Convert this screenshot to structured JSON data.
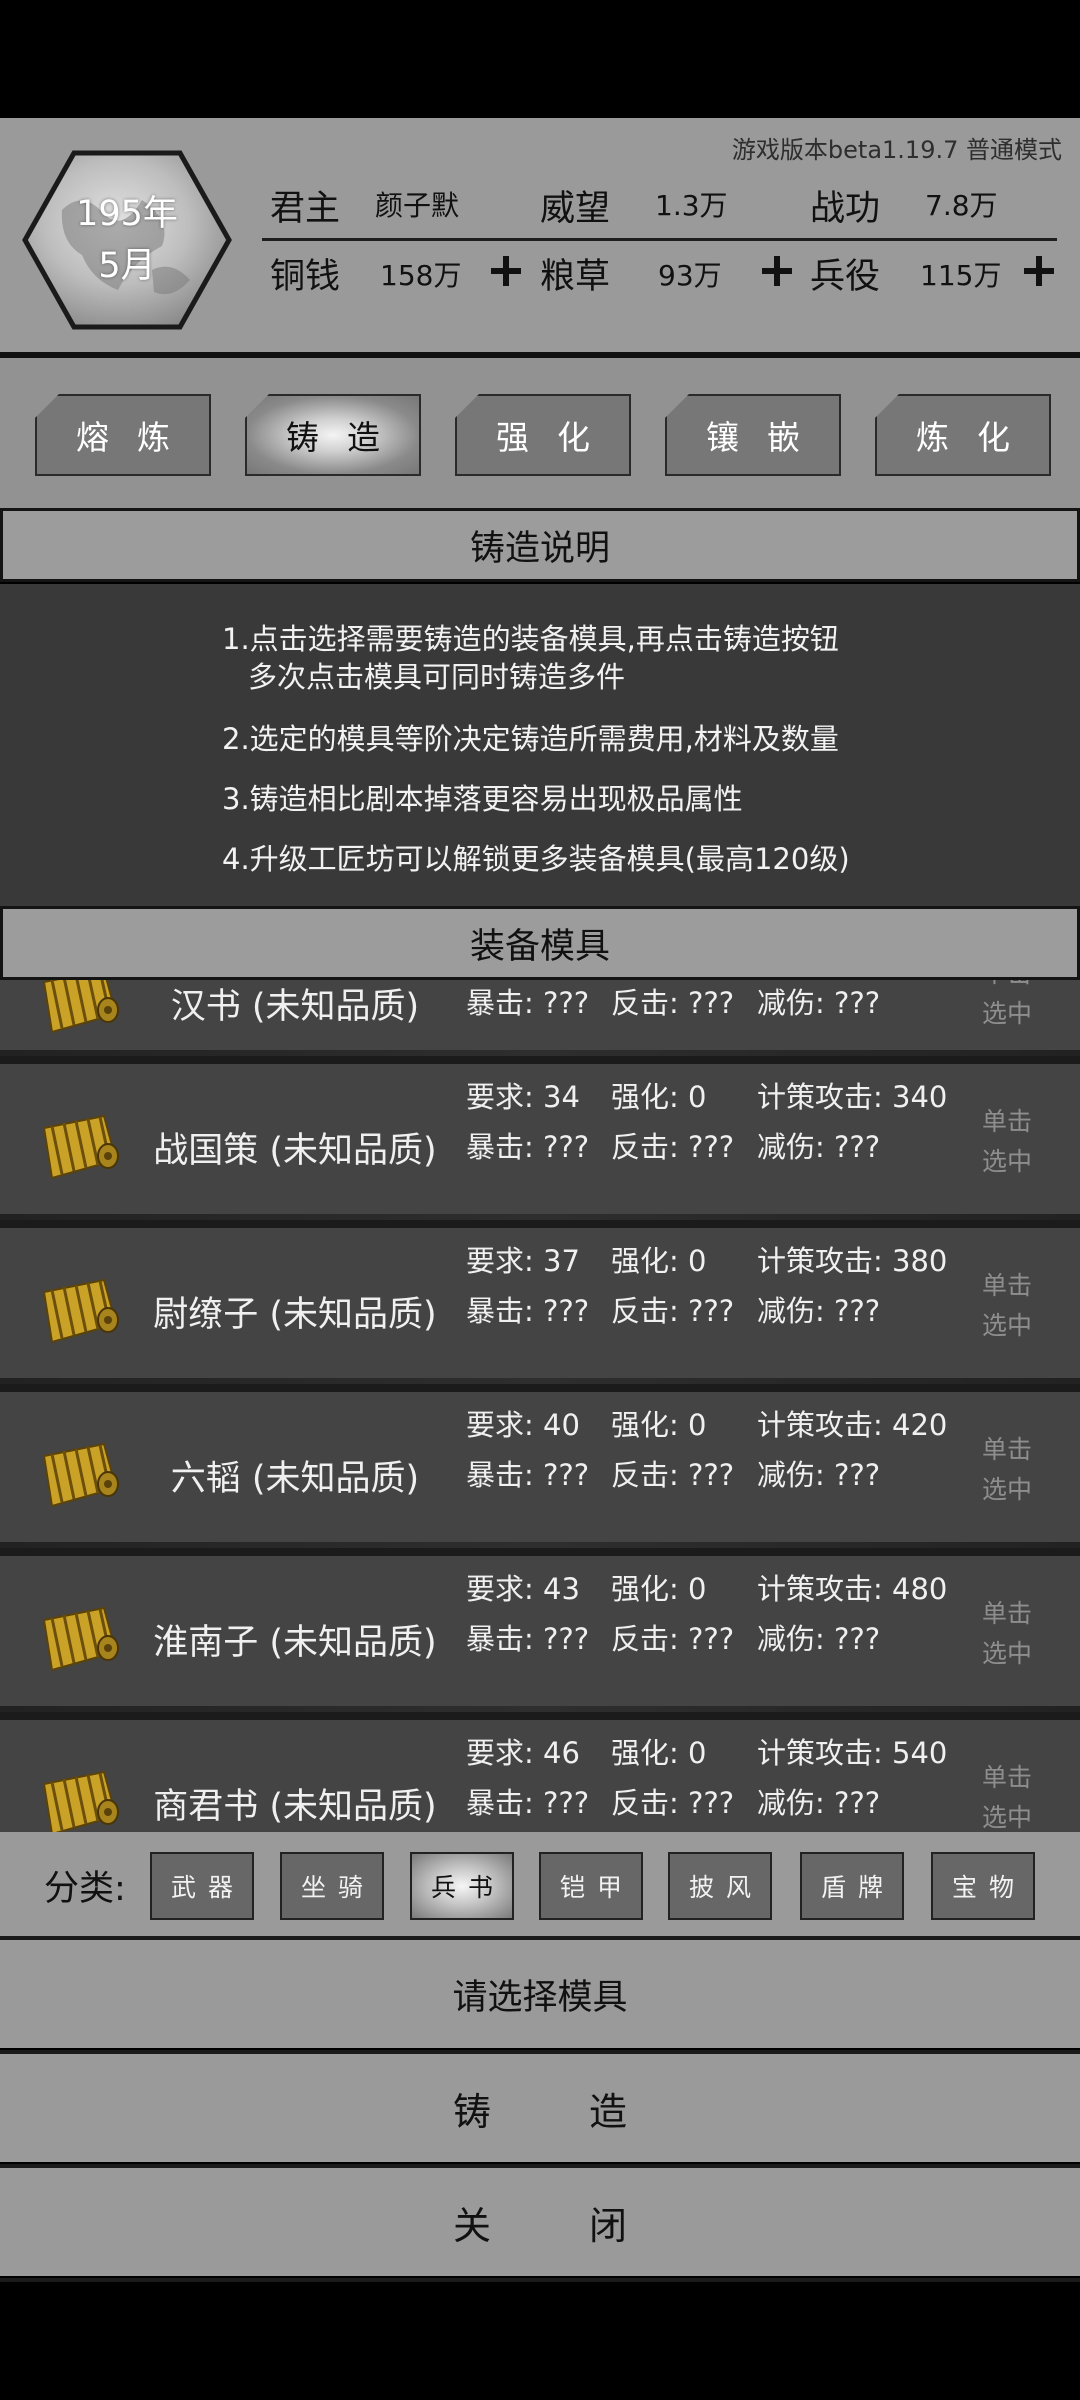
{
  "header": {
    "version": "游戏版本beta1.19.7   普通模式",
    "date_year": "195年",
    "date_month": "5月",
    "stats_row1": [
      {
        "label": "君主",
        "value": "颜子默"
      },
      {
        "label": "威望",
        "value": "1.3万"
      },
      {
        "label": "战功",
        "value": "7.8万"
      }
    ],
    "stats_row2": [
      {
        "label": "铜钱",
        "value": "158万"
      },
      {
        "label": "粮草",
        "value": "93万"
      },
      {
        "label": "兵役",
        "value": "115万"
      }
    ]
  },
  "tabs": [
    {
      "label": "熔炼",
      "active": false
    },
    {
      "label": "铸造",
      "active": true
    },
    {
      "label": "强化",
      "active": false
    },
    {
      "label": "镶嵌",
      "active": false
    },
    {
      "label": "炼化",
      "active": false
    }
  ],
  "description": {
    "title": "铸造说明",
    "lines": [
      "1.点击选择需要铸造的装备模具,再点击铸造按钮",
      "多次点击模具可同时铸造多件",
      "2.选定的模具等阶决定铸造所需费用,材料及数量",
      "3.铸造相比剧本掉落更容易出现极品属性",
      "4.升级工匠坊可以解锁更多装备模具(最高120级)"
    ]
  },
  "molds": {
    "title": "装备模具",
    "items": [
      {
        "name": "汉书 (未知品质)",
        "req": "",
        "enh": "",
        "atk": "",
        "crit": "暴击: ???",
        "counter": "反击: ???",
        "reduce": "减伤: ???",
        "select": "单击选中"
      },
      {
        "name": "战国策 (未知品质)",
        "req": "要求: 34",
        "enh": "强化: 0",
        "atk": "计策攻击: 340",
        "crit": "暴击: ???",
        "counter": "反击: ???",
        "reduce": "减伤: ???",
        "select": "单击选中"
      },
      {
        "name": "尉缭子 (未知品质)",
        "req": "要求: 37",
        "enh": "强化: 0",
        "atk": "计策攻击: 380",
        "crit": "暴击: ???",
        "counter": "反击: ???",
        "reduce": "减伤: ???",
        "select": "单击选中"
      },
      {
        "name": "六韬 (未知品质)",
        "req": "要求: 40",
        "enh": "强化: 0",
        "atk": "计策攻击: 420",
        "crit": "暴击: ???",
        "counter": "反击: ???",
        "reduce": "减伤: ???",
        "select": "单击选中"
      },
      {
        "name": "淮南子 (未知品质)",
        "req": "要求: 43",
        "enh": "强化: 0",
        "atk": "计策攻击: 480",
        "crit": "暴击: ???",
        "counter": "反击: ???",
        "reduce": "减伤: ???",
        "select": "单击选中"
      },
      {
        "name": "商君书 (未知品质)",
        "req": "要求: 46",
        "enh": "强化: 0",
        "atk": "计策攻击: 540",
        "crit": "暴击: ???",
        "counter": "反击: ???",
        "reduce": "减伤: ???",
        "select": "单击选中"
      }
    ]
  },
  "categories": {
    "label": "分类:",
    "items": [
      {
        "label": "武器",
        "active": false
      },
      {
        "label": "坐骑",
        "active": false
      },
      {
        "label": "兵书",
        "active": true
      },
      {
        "label": "铠甲",
        "active": false
      },
      {
        "label": "披风",
        "active": false
      },
      {
        "label": "盾牌",
        "active": false
      },
      {
        "label": "宝物",
        "active": false
      }
    ]
  },
  "footer": {
    "status": "请选择模具",
    "forge_button": "铸造",
    "close_button": "关闭"
  },
  "colors": {
    "panel": "#9a9a9a",
    "row": "#444444",
    "dark": "#393939",
    "scroll_gold": "#c9a227"
  }
}
